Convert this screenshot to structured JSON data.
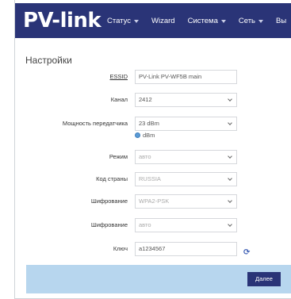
{
  "brand": {
    "logo_text": "PV-link"
  },
  "nav": {
    "items": [
      {
        "label": "Статус",
        "has_caret": true
      },
      {
        "label": "Wizard",
        "has_caret": false
      },
      {
        "label": "Система",
        "has_caret": true
      },
      {
        "label": "Сеть",
        "has_caret": true
      },
      {
        "label": "Вы",
        "has_caret": false
      }
    ]
  },
  "page": {
    "section_title": "Настройки"
  },
  "form": {
    "essid": {
      "label": "ESSID",
      "value": "PV-Link PV-WF5B main"
    },
    "channel": {
      "label": "Канал",
      "value": "2412"
    },
    "tx_power": {
      "label": "Мощность передатчика",
      "value": "23 dBm",
      "unit": "dBm"
    },
    "mode": {
      "label": "Режим",
      "value": "авто"
    },
    "country": {
      "label": "Код страны",
      "value": "RUSSIA"
    },
    "encryption": {
      "label": "Шифрование",
      "value": "WPA2-PSK"
    },
    "cipher": {
      "label": "Шифрование",
      "value": "авто"
    },
    "key": {
      "label": "Ключ",
      "value": "a1234567"
    }
  },
  "footer": {
    "next_label": "Далее"
  },
  "colors": {
    "navbar": "#2a3477",
    "footer": "#b7d6ee",
    "button": "#2a3477",
    "accent_dot": "#5b9bd5"
  },
  "icons": {
    "refresh": "refresh-icon",
    "dropdown": "chevron-down-icon",
    "radio": "radio-dot-icon"
  }
}
